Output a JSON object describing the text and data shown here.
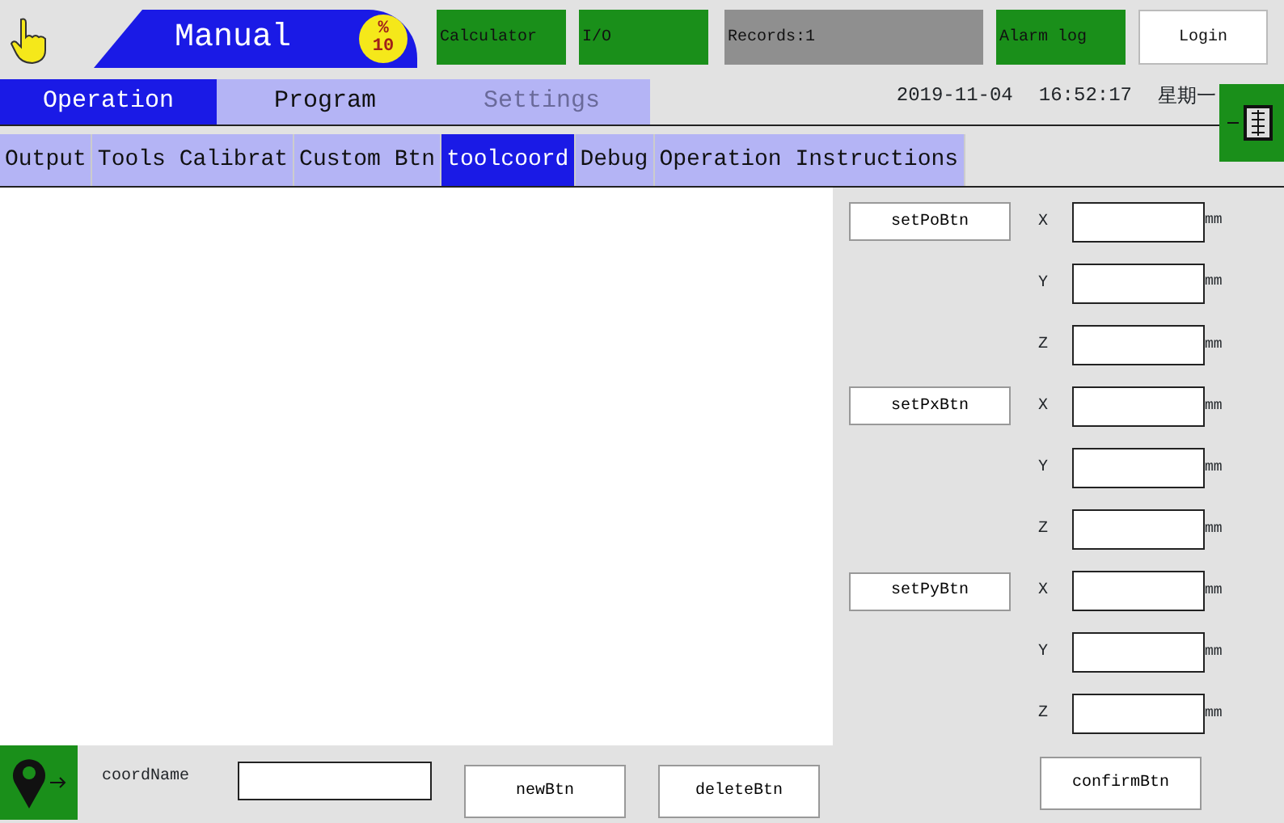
{
  "header": {
    "mode": "Manual",
    "speed_unit": "%",
    "speed": "10",
    "buttons": [
      {
        "label": "Calculator",
        "kind": "green"
      },
      {
        "label": "I/O",
        "kind": "green"
      },
      {
        "label": "Records:1",
        "kind": "grey"
      },
      {
        "label": "Alarm log",
        "kind": "green"
      },
      {
        "label": "Login",
        "kind": "white"
      }
    ]
  },
  "main_tabs": [
    {
      "label": "Operation",
      "selected": true,
      "disabled": false
    },
    {
      "label": "Program",
      "selected": false,
      "disabled": false
    },
    {
      "label": "Settings",
      "selected": false,
      "disabled": true
    }
  ],
  "datetime": {
    "date": "2019-11-04",
    "time": "16:52:17",
    "weekday": "星期一"
  },
  "sub_tabs": [
    {
      "label": "Output",
      "selected": false
    },
    {
      "label": "Tools Calibrat",
      "selected": false
    },
    {
      "label": "Custom Btn",
      "selected": false
    },
    {
      "label": "toolcoord",
      "selected": true
    },
    {
      "label": "Debug",
      "selected": false
    },
    {
      "label": "Operation Instructions",
      "selected": false
    }
  ],
  "point_groups": [
    {
      "button": "setPoBtn",
      "axes": [
        {
          "axis": "X",
          "unit": "mm"
        },
        {
          "axis": "Y",
          "unit": "mm"
        },
        {
          "axis": "Z",
          "unit": "mm"
        }
      ]
    },
    {
      "button": "setPxBtn",
      "axes": [
        {
          "axis": "X",
          "unit": "mm"
        },
        {
          "axis": "Y",
          "unit": "mm"
        },
        {
          "axis": "Z",
          "unit": "mm"
        }
      ]
    },
    {
      "button": "setPyBtn",
      "axes": [
        {
          "axis": "X",
          "unit": "mm"
        },
        {
          "axis": "Y",
          "unit": "mm"
        },
        {
          "axis": "Z",
          "unit": "mm"
        }
      ]
    }
  ],
  "bottom": {
    "name_label": "coordName",
    "buttons": [
      "newBtn",
      "deleteBtn"
    ],
    "confirm": "confirmBtn"
  }
}
